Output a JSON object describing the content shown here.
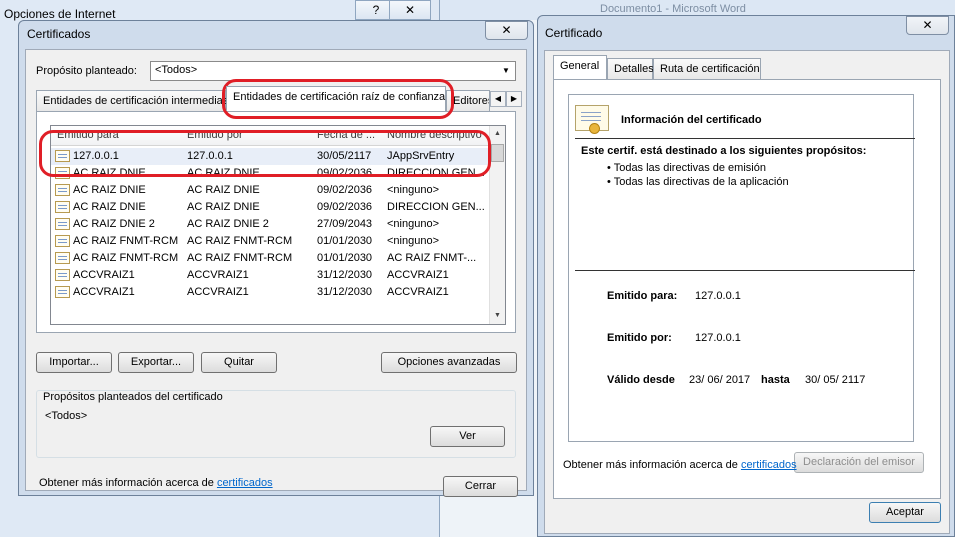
{
  "background": {
    "opciones_title": "Opciones de Internet",
    "help_glyph": "?",
    "close_glyph": "✕",
    "word_title": "Documento1 - Microsoft Word"
  },
  "certificados": {
    "title": "Certificados",
    "purpose_label": "Propósito planteado:",
    "purpose_value": "<Todos>",
    "tabs": [
      "Entidades de certificación intermedias",
      "Entidades de certificación raíz de confianza",
      "Editores"
    ],
    "columns": [
      "Emitido para",
      "Emitido por",
      "Fecha de ...",
      "Nombre descriptivo"
    ],
    "rows": [
      [
        "127.0.0.1",
        "127.0.0.1",
        "30/05/2117",
        "JAppSrvEntry"
      ],
      [
        "AC RAIZ DNIE",
        "AC RAIZ DNIE",
        "09/02/2036",
        "DIRECCION GEN..."
      ],
      [
        "AC RAIZ DNIE",
        "AC RAIZ DNIE",
        "09/02/2036",
        "<ninguno>"
      ],
      [
        "AC RAIZ DNIE",
        "AC RAIZ DNIE",
        "09/02/2036",
        "DIRECCION GEN..."
      ],
      [
        "AC RAIZ DNIE 2",
        "AC RAIZ DNIE 2",
        "27/09/2043",
        "<ninguno>"
      ],
      [
        "AC RAIZ FNMT-RCM",
        "AC RAIZ FNMT-RCM",
        "01/01/2030",
        "<ninguno>"
      ],
      [
        "AC RAIZ FNMT-RCM",
        "AC RAIZ FNMT-RCM",
        "01/01/2030",
        "AC RAIZ FNMT-..."
      ],
      [
        "ACCVRAIZ1",
        "ACCVRAIZ1",
        "31/12/2030",
        "ACCVRAIZ1"
      ],
      [
        "ACCVRAIZ1",
        "ACCVRAIZ1",
        "31/12/2030",
        "ACCVRAIZ1"
      ]
    ],
    "buttons": {
      "importar": "Importar...",
      "exportar": "Exportar...",
      "quitar": "Quitar",
      "opciones": "Opciones avanzadas",
      "ver": "Ver",
      "cerrar": "Cerrar"
    },
    "group_label": "Propósitos planteados del certificado",
    "group_value": "<Todos>",
    "info_text": "Obtener más información acerca de",
    "info_link": "certificados"
  },
  "certificado": {
    "title": "Certificado",
    "tabs": [
      "General",
      "Detalles",
      "Ruta de certificación"
    ],
    "info_title": "Información del certificado",
    "purpose_heading": "Este certif. está destinado a los siguientes propósitos:",
    "purposes": [
      "• Todas las directivas de emisión",
      "• Todas las directivas de la aplicación"
    ],
    "issued_to_label": "Emitido para:",
    "issued_to": "127.0.0.1",
    "issued_by_label": "Emitido por:",
    "issued_by": "127.0.0.1",
    "valid_from_label": "Válido desde",
    "valid_from": "23/ 06/ 2017",
    "valid_to_label": "hasta",
    "valid_to": "30/ 05/ 2117",
    "issuer_statement": "Declaración del emisor",
    "info_text": "Obtener más información acerca de",
    "info_link": "certificados",
    "accept": "Aceptar"
  },
  "colors": {
    "highlight": "#e01e26",
    "link": "#0066cc"
  },
  "icons": [
    "certificate-icon",
    "certificate-seal-icon",
    "chevron-down-icon",
    "scroll-arrow-icon"
  ]
}
